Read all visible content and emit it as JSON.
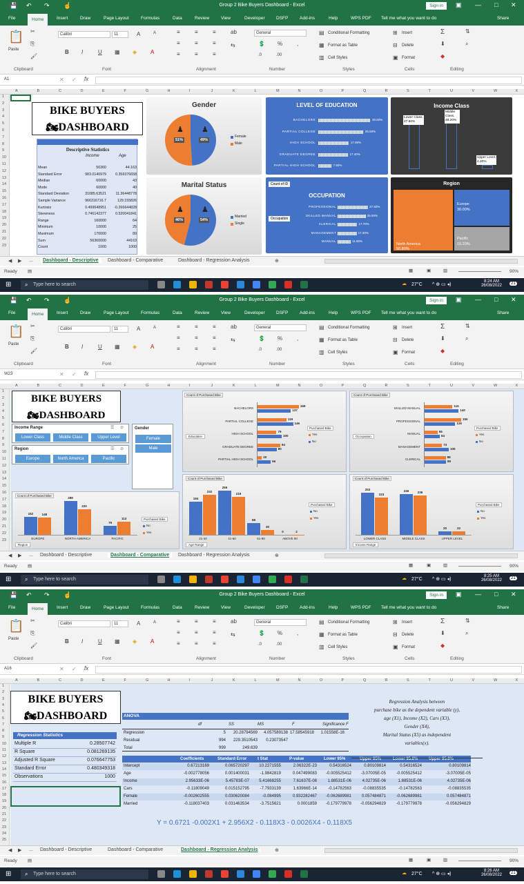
{
  "app": {
    "title": "Group 2 Bike Buyers Dashboard  -  Excel",
    "sign_in": "Sign in",
    "tell_me": "Tell me what you want to do",
    "share": "Share"
  },
  "tabs": [
    "File",
    "Home",
    "Insert",
    "Draw",
    "Page Layout",
    "Formulas",
    "Data",
    "Review",
    "View",
    "Developer",
    "DSFP",
    "Add-ins",
    "Help",
    "WPS PDF"
  ],
  "ribbon": {
    "paste": "Paste",
    "font": "Calibri",
    "size": "11",
    "number_format": "General",
    "cond_format": "Conditional Formatting",
    "format_table": "Format as Table",
    "cell_styles": "Cell Styles",
    "insert": "Insert",
    "delete": "Delete",
    "format": "Format",
    "groups": [
      "Clipboard",
      "Font",
      "Alignment",
      "Number",
      "Styles",
      "Cells",
      "Editing"
    ]
  },
  "sheets": [
    "Dashboard - Descriptive",
    "Dashboard - Comparative",
    "Dashboard - Regression Analysis"
  ],
  "status": {
    "ready": "Ready",
    "zoom": "90%"
  },
  "taskbar": {
    "search": "Type here to search",
    "temp": "27°C",
    "date": "26/08/2022",
    "badge": "21"
  },
  "dashboard_title": [
    "BIKE BUYERS",
    "DASHBOARD"
  ],
  "shot1": {
    "name_box": "A1",
    "time": "8:24 AM",
    "desc": {
      "title": "Descriptive Statistics",
      "cols": [
        "Income",
        "Age"
      ],
      "rows": [
        [
          "Mean",
          "56360",
          "44.163"
        ],
        [
          "Standard Error",
          "983.0140979",
          "0.359376658"
        ],
        [
          "Median",
          "60000",
          "43"
        ],
        [
          "Mode",
          "60000",
          "40"
        ],
        [
          "Standard Deviation",
          "31085.63521",
          "11.36448778"
        ],
        [
          "Sample Variance",
          "966316716.7",
          "129.155826"
        ],
        [
          "Kurtosis",
          "0.499648951",
          "-0.266644828"
        ],
        [
          "Skewness",
          "0.746142377",
          "0.520041841"
        ],
        [
          "Range",
          "160000",
          "64"
        ],
        [
          "Minimum",
          "10000",
          "25"
        ],
        [
          "Maximum",
          "170000",
          "89"
        ],
        [
          "Sum",
          "56360000",
          "44163"
        ],
        [
          "Count",
          "1000",
          "1000"
        ]
      ]
    },
    "gender": {
      "title": "Gender",
      "female_pct": "51%",
      "male_pct": "49%",
      "legend": [
        "Female",
        "Male"
      ]
    },
    "marital": {
      "title": "Marital Status",
      "a": "46%",
      "b": "54%",
      "legend": [
        "Married",
        "Single"
      ]
    },
    "education": {
      "title": "LEVEL OF EDUCATION",
      "items": [
        [
          "BACHELORS",
          "30.60%"
        ],
        [
          "PARTIAL COLLEGE",
          "26.50%"
        ],
        [
          "HIGH SCHOOL",
          "17.90%"
        ],
        [
          "GRADUATE DEGREE",
          "17.40%"
        ],
        [
          "PARTIAL HIGH SCHOOL",
          "7.60%"
        ]
      ]
    },
    "income": {
      "title": "Income Class",
      "labels": [
        [
          "Lower Class,",
          "47.60%"
        ],
        [
          "Middle Class,",
          "48.20%"
        ],
        [
          "Upper Level,",
          "4.20%"
        ]
      ]
    },
    "occupation": {
      "title": "OCCUPATION",
      "count": "Count of ID",
      "filter": "Occupation",
      "items": [
        [
          "PROFESSIONAL",
          "27.60%"
        ],
        [
          "SKILLED MANUAL",
          "25.50%"
        ],
        [
          "CLERICAL",
          "17.70%"
        ],
        [
          "MANAGEMENT",
          "17.30%"
        ],
        [
          "MANUAL",
          "11.90%"
        ]
      ]
    },
    "region": {
      "title": "Region",
      "items": [
        [
          "North America",
          "50.80%"
        ],
        [
          "Europe",
          "30.00%"
        ],
        [
          "Pacific",
          "19.20%"
        ]
      ]
    }
  },
  "shot2": {
    "name_box": "W23",
    "time": "8:25 AM",
    "slicers": {
      "income_title": "Income Range",
      "income": [
        "Lower Class",
        "Middle Class",
        "Upper Level"
      ],
      "region_title": "Region",
      "region": [
        "Europe",
        "North America",
        "Pacific"
      ],
      "gender_title": "Gender",
      "gender": [
        "Female",
        "Male"
      ]
    },
    "count_label": "Count of Purchased Bike",
    "legend_title": "Purchased Bike",
    "yes": "Yes",
    "no": "No",
    "education": {
      "filter": "Education",
      "cats": [
        "BACHELORS",
        "PARTIAL COLLEGE",
        "HIGH SCHOOL",
        "GRADUATE DEGREE",
        "PARTIAL HIGH SCHOOL"
      ],
      "yes": [
        169,
        119,
        79,
        94,
        20
      ],
      "no": [
        137,
        146,
        100,
        80,
        56
      ]
    },
    "occupation": {
      "filter": "Occupation",
      "cats": [
        "SKILLED MANUAL",
        "PROFESSIONAL",
        "MANUAL",
        "MANAGEMENT",
        "CLERICAL"
      ],
      "yes": [
        115,
        150,
        55,
        73,
        88
      ],
      "no": [
        140,
        126,
        64,
        100,
        89
      ]
    },
    "region": {
      "filter": "Region",
      "cats": [
        "EUROPE",
        "NORTH AMERICA",
        "PACIFIC"
      ],
      "no": [
        152,
        288,
        79
      ],
      "yes": [
        148,
        220,
        113
      ]
    },
    "age": {
      "filter": "Age Range",
      "cats": [
        "21-40",
        "41-60",
        "61-80",
        "ABOVE 80"
      ],
      "no": [
        194,
        255,
        68,
        0
      ],
      "yes": [
        232,
        219,
        30,
        2
      ]
    },
    "income": {
      "filter": "Income Range",
      "cats": [
        "LOWER CLASS",
        "MIDDLE CLASS",
        "UPPER LEVEL"
      ],
      "no": [
        253,
        246,
        20
      ],
      "yes": [
        223,
        236,
        22
      ]
    }
  },
  "shot3": {
    "name_box": "A16",
    "time": "8:26 AM",
    "reg_stats": {
      "title": "Regression Statistics",
      "rows": [
        [
          "Multiple R",
          "0.28507742"
        ],
        [
          "R Square",
          "0.081269135"
        ],
        [
          "Adjusted R Square",
          "0.076647753"
        ],
        [
          "Standard Error",
          "0.480349318"
        ],
        [
          "Observations",
          "1000"
        ]
      ]
    },
    "anova": {
      "title": "ANOVA",
      "cols": [
        "df",
        "SS",
        "MS",
        "F",
        "Significance F"
      ],
      "rows": [
        [
          "Regression",
          "5",
          "20.28794569",
          "4.057589138",
          "17.58545918",
          "1.01558E-16"
        ],
        [
          "Residual",
          "994",
          "229.3510543",
          "0.23073547",
          "",
          ""
        ],
        [
          "Total",
          "999",
          "249.639",
          "",
          "",
          ""
        ]
      ]
    },
    "coef": {
      "cols": [
        "Coefficients",
        "Standard Error",
        "t Stat",
        "P-value",
        "Lower 95%",
        "Upper 95%",
        "Lower 95.0%",
        "Upper 95.0%"
      ],
      "rows": [
        [
          "Intercept",
          "0.67213169",
          "0.065720297",
          "10.2271555",
          "2.06322E-23",
          "0.54316524",
          "0.80109814",
          "0.54316524",
          "0.80109814"
        ],
        [
          "Age",
          "-0.002778056",
          "0.001400031",
          "-1.9842819",
          "0.047499083",
          "-0.005525412",
          "-3.07005E-05",
          "-0.005525412",
          "-3.07005E-05"
        ],
        [
          "Income",
          "2.95633E-06",
          "5.45783E-07",
          "5.41668255",
          "7.61637E-08",
          "1.88531E-06",
          "4.02735E-06",
          "1.88531E-06",
          "4.02735E-06"
        ],
        [
          "Cars",
          "-0.11809049",
          "0.015152795",
          "-7.7933139",
          "1.63966E-14",
          "-0.14782563",
          "-0.08835535",
          "-0.14782563",
          "-0.08835535"
        ],
        [
          "Female",
          "-0.002602555",
          "0.030620084",
          "-0.084995",
          "0.932282467",
          "-0.062689981",
          "0.057484871",
          "-0.062689981",
          "0.057484871"
        ],
        [
          "Married",
          "-0.118037403",
          "0.031463534",
          "-3.7515621",
          "0.0001859",
          "-0.179779978",
          "-0.056294829",
          "-0.179779978",
          "-0.056294829"
        ]
      ]
    },
    "note": [
      "Regression Analysis between",
      "purchase bike  as the dependent variable (y),",
      "age (X1),  Income (X2),  Cars (X3),",
      "Gender (X4),",
      "Marital Status (X5) as independent",
      "variables(x)."
    ],
    "equation": "Y = 0.6721 -0.002X1 + 2.956X2 -  0.118X3 - 0.0026X4 - 0.118X5"
  },
  "colors": {
    "excel_green": "#217346",
    "blue": "#4472c4",
    "orange": "#ed7d31",
    "dark": "#3b3b3b"
  }
}
